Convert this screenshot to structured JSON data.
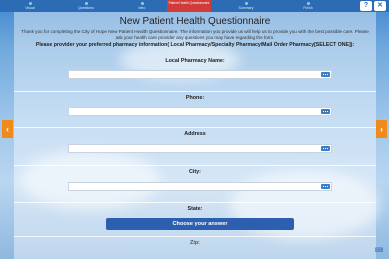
{
  "progress": {
    "steps": [
      {
        "label": "Visual",
        "active": false
      },
      {
        "label": "Questions",
        "active": false
      },
      {
        "label": "Intro",
        "active": false
      },
      {
        "label": "Patient Health Questionnaire",
        "active": true
      },
      {
        "label": "Summary",
        "active": false
      },
      {
        "label": "Finish",
        "active": false
      }
    ],
    "help_label": "?",
    "close_label": "✕"
  },
  "form": {
    "title": "New Patient Health Questionnaire",
    "intro": "Thank you for completing the City of Hope New Patient Health Questionnaire. The information you provide us will help us to provide you with the best possible care. Please ask your health care provider any questions you may have regarding the form.",
    "question": "Please provider your preferred pharmacy information( Local Pharmacy/Specialty Pharmacy/Mail Order Pharmacy[SELECT ONE]):",
    "fields": [
      {
        "label": "Local Pharmacy Name:",
        "value": ""
      },
      {
        "label": "Phone:",
        "value": ""
      },
      {
        "label": "Address",
        "value": ""
      },
      {
        "label": "City:",
        "value": ""
      }
    ],
    "state_label": "State:",
    "state_button": "Choose your answer",
    "zip_label": "Zip:"
  },
  "nav": {
    "prev_icon": "chevron-left-icon",
    "next_icon": "chevron-right-icon",
    "prev_glyph": "‹",
    "next_glyph": "›"
  },
  "colors": {
    "accent": "#2d5fb0",
    "nav_arrow": "#f08a1c",
    "active_step": "#d23b3b"
  }
}
